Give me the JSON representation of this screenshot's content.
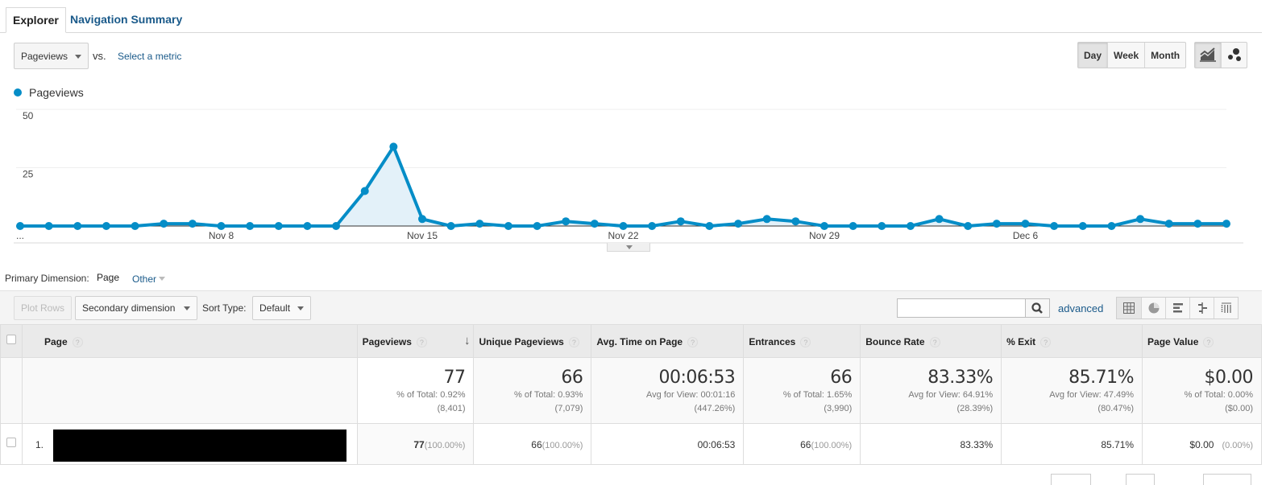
{
  "tabs": [
    {
      "label": "Explorer",
      "active": true
    },
    {
      "label": "Navigation Summary",
      "active": false
    }
  ],
  "metric_selector": {
    "selected": "Pageviews",
    "vs_label": "vs.",
    "compare_link": "Select a metric"
  },
  "range_buttons": [
    {
      "label": "Day",
      "active": true
    },
    {
      "label": "Week",
      "active": false
    },
    {
      "label": "Month",
      "active": false
    }
  ],
  "chart_view_buttons": [
    {
      "icon": "line-chart-icon",
      "active": true
    },
    {
      "icon": "motion-chart-icon",
      "active": false
    }
  ],
  "colors": {
    "series": "#058dc7",
    "area_fill": "#e3f1f9",
    "link": "#1a5a8a"
  },
  "chart_data": {
    "type": "area",
    "title": "",
    "legend": [
      "Pageviews"
    ],
    "legend_position": "top-left",
    "xlabel": "",
    "ylabel": "",
    "ylim": [
      0,
      50
    ],
    "yticks": [
      25,
      50
    ],
    "grid": true,
    "x_tick_labels": [
      {
        "index": 0,
        "label": "..."
      },
      {
        "index": 7,
        "label": "Nov 8"
      },
      {
        "index": 14,
        "label": "Nov 15"
      },
      {
        "index": 21,
        "label": "Nov 22"
      },
      {
        "index": 28,
        "label": "Nov 29"
      },
      {
        "index": 35,
        "label": "Dec 6"
      }
    ],
    "x": [
      "Nov 1",
      "Nov 2",
      "Nov 3",
      "Nov 4",
      "Nov 5",
      "Nov 6",
      "Nov 7",
      "Nov 8",
      "Nov 9",
      "Nov 10",
      "Nov 11",
      "Nov 12",
      "Nov 13",
      "Nov 14",
      "Nov 15",
      "Nov 16",
      "Nov 17",
      "Nov 18",
      "Nov 19",
      "Nov 20",
      "Nov 21",
      "Nov 22",
      "Nov 23",
      "Nov 24",
      "Nov 25",
      "Nov 26",
      "Nov 27",
      "Nov 28",
      "Nov 29",
      "Nov 30",
      "Dec 1",
      "Dec 2",
      "Dec 3",
      "Dec 4",
      "Dec 5",
      "Dec 6",
      "Dec 7",
      "Dec 8",
      "Dec 9",
      "Dec 10",
      "Dec 11",
      "Dec 12",
      "Dec 13"
    ],
    "series": [
      {
        "name": "Pageviews",
        "values": [
          0,
          0,
          0,
          0,
          0,
          1,
          1,
          0,
          0,
          0,
          0,
          0,
          15,
          34,
          3,
          0,
          1,
          0,
          0,
          2,
          1,
          0,
          0,
          2,
          0,
          1,
          3,
          2,
          0,
          0,
          0,
          0,
          3,
          0,
          1,
          1,
          0,
          0,
          0,
          3,
          1,
          1,
          1
        ]
      }
    ]
  },
  "primary_dimension": {
    "label": "Primary Dimension:",
    "selected": "Page",
    "other": "Other"
  },
  "toolbar": {
    "plot_rows": "Plot Rows",
    "secondary_dimension": "Secondary dimension",
    "sort_type_label": "Sort Type:",
    "sort_type_value": "Default",
    "search_value": "",
    "advanced": "advanced"
  },
  "table": {
    "columns": [
      {
        "label": "Page"
      },
      {
        "label": "Pageviews",
        "sorted": "desc"
      },
      {
        "label": "Unique Pageviews"
      },
      {
        "label": "Avg. Time on Page"
      },
      {
        "label": "Entrances"
      },
      {
        "label": "Bounce Rate"
      },
      {
        "label": "% Exit"
      },
      {
        "label": "Page Value"
      }
    ],
    "totals": [
      {
        "value": "77",
        "line1": "% of Total: 0.92%",
        "line2": "(8,401)"
      },
      {
        "value": "66",
        "line1": "% of Total: 0.93%",
        "line2": "(7,079)"
      },
      {
        "value": "00:06:53",
        "line1": "Avg for View: 00:01:16",
        "line2": "(447.26%)"
      },
      {
        "value": "66",
        "line1": "% of Total: 1.65%",
        "line2": "(3,990)"
      },
      {
        "value": "83.33%",
        "line1": "Avg for View: 64.91%",
        "line2": "(28.39%)"
      },
      {
        "value": "85.71%",
        "line1": "Avg for View: 47.49%",
        "line2": "(80.47%)"
      },
      {
        "value": "$0.00",
        "line1": "% of Total: 0.00%",
        "line2": "($0.00)"
      }
    ],
    "rows": [
      {
        "index": "1.",
        "page": "[redacted]",
        "pageviews": "77",
        "pageviews_pct": "(100.00%)",
        "unique_pageviews": "66",
        "unique_pageviews_pct": "(100.00%)",
        "avg_time": "00:06:53",
        "entrances": "66",
        "entrances_pct": "(100.00%)",
        "bounce_rate": "83.33%",
        "exit": "85.71%",
        "page_value": "$0.00",
        "page_value_pct": "(0.00%)"
      }
    ]
  }
}
